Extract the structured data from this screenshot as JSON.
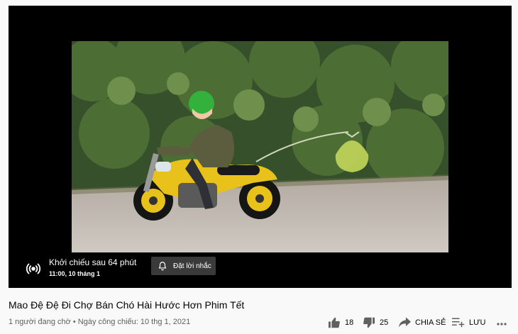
{
  "video": {
    "premiere_label": "Khởi chiếu sau 64 phút",
    "premiere_time": "11:00, 10 tháng 1",
    "remind_label": "Đặt lời nhắc"
  },
  "info": {
    "title": "Mao Đệ Đệ Đi Chợ Bán Chó Hài Hước Hơn Phim Tết",
    "meta": "1 người đang chờ • Ngày công chiếu: 10 thg 1, 2021"
  },
  "actions": {
    "like_count": "18",
    "dislike_count": "25",
    "share_label": "CHIA SẺ",
    "save_label": "LƯU"
  },
  "icons": [
    "live-broadcast-icon",
    "bell-icon",
    "thumbs-up-icon",
    "thumbs-down-icon",
    "share-icon",
    "playlist-add-icon",
    "more-icon"
  ]
}
